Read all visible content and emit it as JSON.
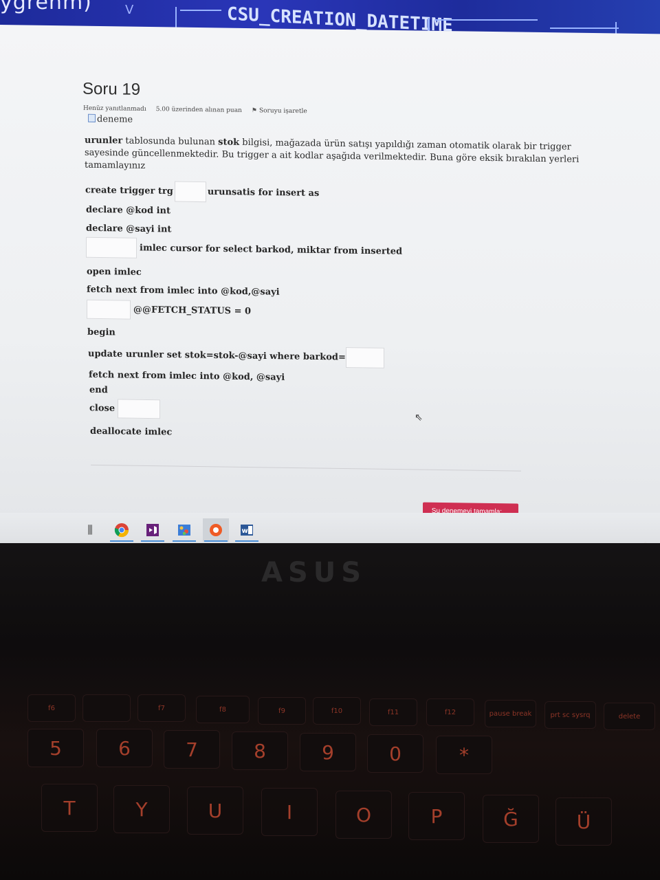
{
  "banner": {
    "left_text": "ygrenm)",
    "chevron": "V",
    "code_text": "CSU_CREATION_DATETIME"
  },
  "question": {
    "title": "Soru 19",
    "status": "Henüz yanıtlanmadı",
    "points": "5.00 üzerinden alınan puan",
    "flag_label": "Soruyu işaretle",
    "image_alt": "deneme",
    "text_bold_1": "urunler",
    "text_1": " tablosunda bulunan ",
    "text_bold_2": "stok",
    "text_2": " bilgisi, mağazada ürün satışı yapıldığı zaman otomatik olarak bir trigger",
    "text_3": "sayesinde güncellenmektedir. Bu trigger a ait kodlar aşağıda verilmektedir. Buna göre eksik bırakılan yerleri",
    "text_4": "tamamlayınız"
  },
  "code_lines": {
    "l1_a": "create trigger trg",
    "l1_b": "urunsatis for insert as",
    "l2": "declare @kod int",
    "l3": "declare @sayi int",
    "l4": "imlec cursor for select barkod, miktar from inserted",
    "l5": "open imlec",
    "l6": "fetch next from imlec into @kod,@sayi",
    "l7": "@@FETCH_STATUS = 0",
    "l8": "begin",
    "l9": "update urunler set stok=stok-@sayi where barkod=",
    "l10": "fetch next from imlec into @kod, @sayi",
    "l11": "end",
    "l12": "close",
    "l13": "deallocate imlec"
  },
  "finish_button": "Şu denemeyi tamamla: ...",
  "taskbar": {
    "items": [
      "task-view",
      "chrome",
      "visual-studio",
      "paint",
      "media-app",
      "word"
    ],
    "word_label": "w"
  },
  "keyboard": {
    "brand": "ASUS",
    "fkeys": [
      "f6",
      "f7",
      "f8",
      "f9",
      "f10",
      "f11",
      "f12",
      "pause break",
      "prt sc sysrq",
      "delete"
    ],
    "number_row": [
      "5",
      "6",
      "7",
      "8",
      "9",
      "0",
      "*"
    ],
    "letter_row": [
      "T",
      "Y",
      "U",
      "I",
      "O",
      "P",
      "Ğ",
      "Ü"
    ]
  }
}
